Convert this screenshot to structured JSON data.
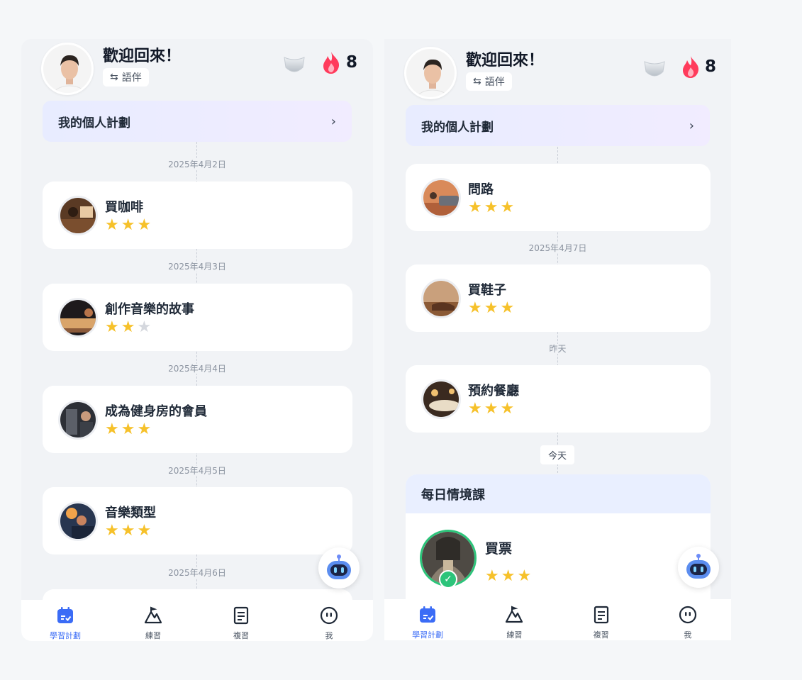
{
  "header": {
    "welcome": "歡迎回來！",
    "partner_label": "語伴",
    "streak": "8"
  },
  "plan": {
    "title": "我的個人計劃",
    "chevron": "›"
  },
  "left_screen": {
    "lessons": [
      {
        "date": "2025年4月2日",
        "title": "買咖啡",
        "stars": 3
      },
      {
        "date": "2025年4月3日",
        "title": "創作音樂的故事",
        "stars": 2
      },
      {
        "date": "2025年4月4日",
        "title": "成為健身房的會員",
        "stars": 3
      },
      {
        "date": "2025年4月5日",
        "title": "音樂類型",
        "stars": 3
      },
      {
        "date": "2025年4月6日"
      }
    ]
  },
  "right_screen": {
    "lessons": [
      {
        "title": "問路",
        "stars": 3
      },
      {
        "date": "2025年4月7日",
        "title": "買鞋子",
        "stars": 3
      },
      {
        "date": "昨天",
        "title": "預約餐廳",
        "stars": 3
      }
    ],
    "today_label": "今天",
    "daily": {
      "header": "每日情境課",
      "title": "買票",
      "stars": 3
    }
  },
  "tabs": [
    {
      "label": "學習計劃",
      "icon": "calendar-check-icon",
      "active": true
    },
    {
      "label": "練習",
      "icon": "mountain-icon",
      "active": false
    },
    {
      "label": "複習",
      "icon": "notes-icon",
      "active": false
    },
    {
      "label": "我",
      "icon": "face-icon",
      "active": false
    }
  ],
  "colors": {
    "accent": "#3b6cf6",
    "star": "#f6c12a",
    "success": "#2cc47a",
    "flame": "#ff3b5c"
  }
}
